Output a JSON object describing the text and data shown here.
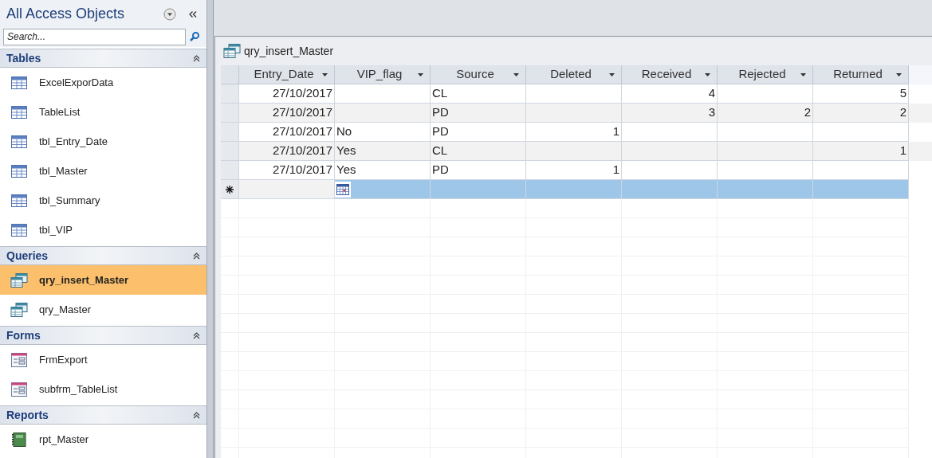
{
  "nav_pane": {
    "title": "All Access Objects",
    "search": {
      "placeholder": "Search..."
    },
    "groups": [
      {
        "label": "Tables",
        "kind": "table",
        "expanded": true,
        "items": [
          {
            "label": "ExcelExporData",
            "selected": false
          },
          {
            "label": "TableList",
            "selected": false
          },
          {
            "label": "tbl_Entry_Date",
            "selected": false
          },
          {
            "label": "tbl_Master",
            "selected": false
          },
          {
            "label": "tbl_Summary",
            "selected": false
          },
          {
            "label": "tbl_VIP",
            "selected": false
          }
        ]
      },
      {
        "label": "Queries",
        "kind": "query",
        "expanded": true,
        "items": [
          {
            "label": "qry_insert_Master",
            "selected": true
          },
          {
            "label": "qry_Master",
            "selected": false
          }
        ]
      },
      {
        "label": "Forms",
        "kind": "form",
        "expanded": true,
        "items": [
          {
            "label": "FrmExport",
            "selected": false
          },
          {
            "label": "subfrm_TableList",
            "selected": false
          }
        ]
      },
      {
        "label": "Reports",
        "kind": "report",
        "expanded": true,
        "items": [
          {
            "label": "rpt_Master",
            "selected": false
          }
        ]
      }
    ]
  },
  "document": {
    "title": "qry_insert_Master",
    "table": {
      "columns": [
        {
          "label": "Entry_Date",
          "kind": "date"
        },
        {
          "label": "VIP_flag",
          "kind": "text"
        },
        {
          "label": "Source",
          "kind": "text"
        },
        {
          "label": "Deleted",
          "kind": "number"
        },
        {
          "label": "Received",
          "kind": "number"
        },
        {
          "label": "Rejected",
          "kind": "number"
        },
        {
          "label": "Returned",
          "kind": "number"
        }
      ],
      "rows": [
        [
          "27/10/2017",
          "",
          "CL",
          "",
          "4",
          "",
          "5"
        ],
        [
          "27/10/2017",
          "",
          "PD",
          "",
          "3",
          "2",
          "2"
        ],
        [
          "27/10/2017",
          "No",
          "PD",
          "1",
          "",
          "",
          ""
        ],
        [
          "27/10/2017",
          "Yes",
          "CL",
          "",
          "",
          "",
          "1"
        ],
        [
          "27/10/2017",
          "Yes",
          "PD",
          "1",
          "",
          "",
          ""
        ]
      ],
      "new_row": {
        "selected": true
      }
    }
  }
}
